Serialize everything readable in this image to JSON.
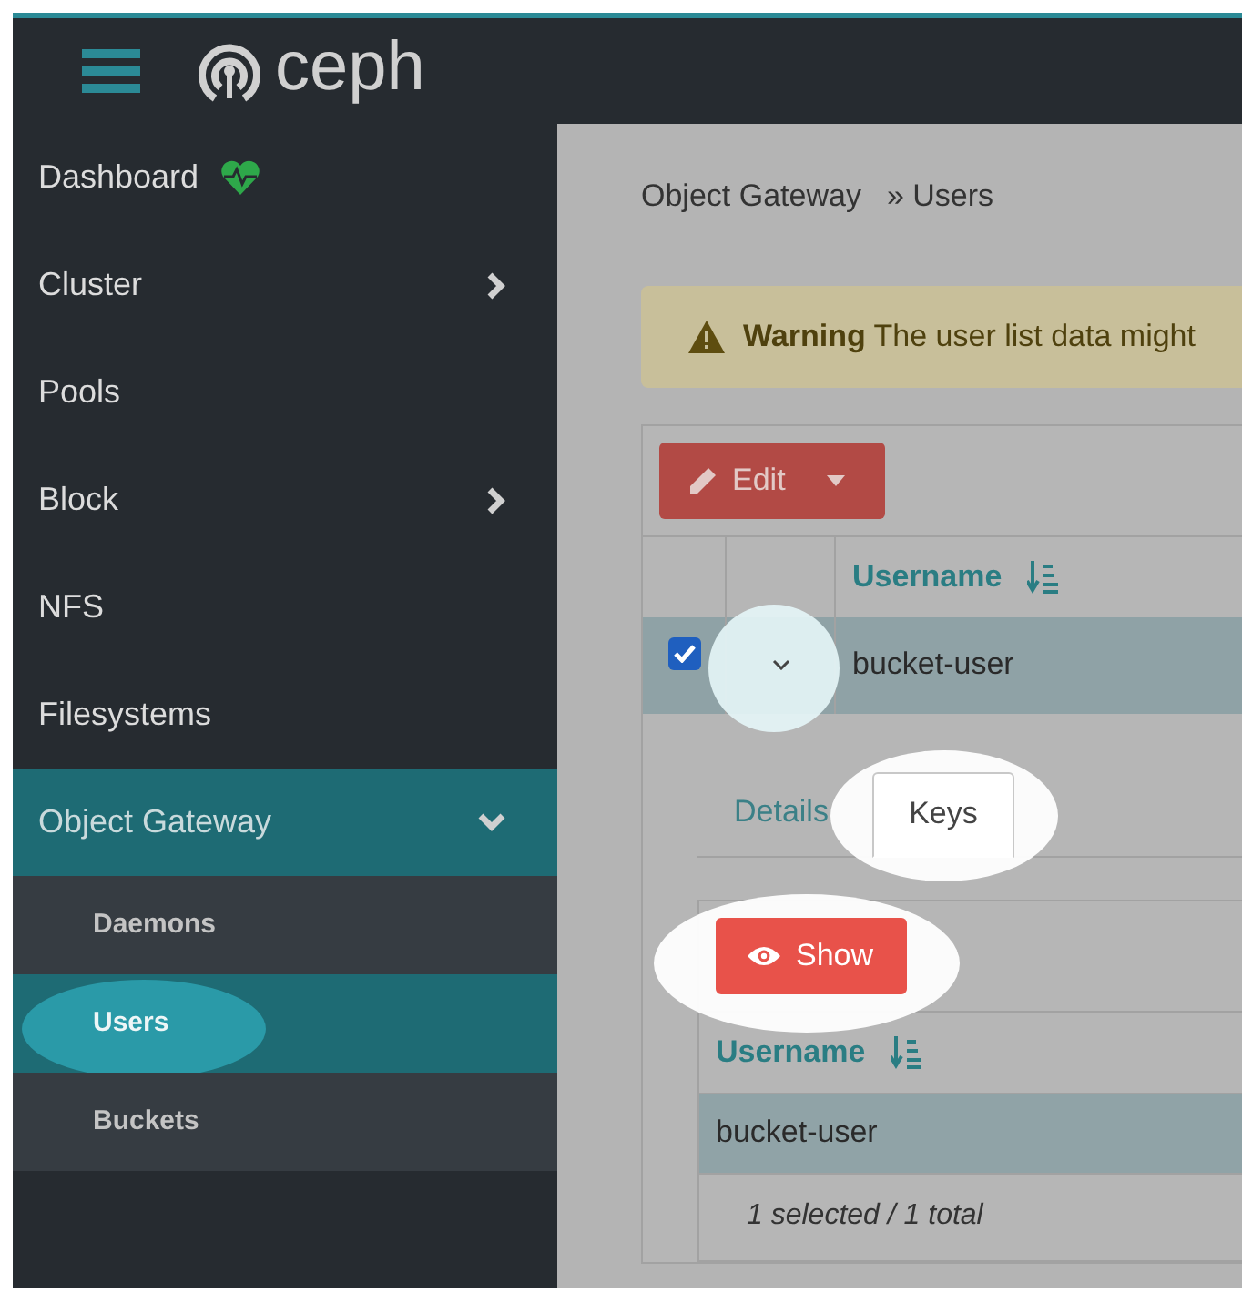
{
  "header": {
    "logo_text": "ceph"
  },
  "sidebar": {
    "items": [
      {
        "label": "Dashboard",
        "kind": "health",
        "selected": false
      },
      {
        "label": "Cluster",
        "kind": "group",
        "selected": false,
        "expanded": false
      },
      {
        "label": "Pools",
        "kind": "link",
        "selected": false
      },
      {
        "label": "Block",
        "kind": "group",
        "selected": false,
        "expanded": false
      },
      {
        "label": "NFS",
        "kind": "link",
        "selected": false
      },
      {
        "label": "Filesystems",
        "kind": "link",
        "selected": false
      },
      {
        "label": "Object Gateway",
        "kind": "group",
        "selected": true,
        "expanded": true,
        "children": [
          {
            "label": "Daemons",
            "selected": false
          },
          {
            "label": "Users",
            "selected": true
          },
          {
            "label": "Buckets",
            "selected": false
          }
        ]
      }
    ]
  },
  "breadcrumb": {
    "items": [
      "Object Gateway",
      "Users"
    ],
    "separator": "»"
  },
  "warning": {
    "title": "Warning",
    "text": "The user list data might"
  },
  "toolbar": {
    "edit_button": "Edit"
  },
  "table": {
    "columns": [
      "Username"
    ],
    "rows": [
      {
        "selected": true,
        "expanded": true,
        "cells": [
          "bucket-user"
        ]
      }
    ]
  },
  "detail": {
    "tabs": [
      {
        "label": "Details",
        "selected": false
      },
      {
        "label": "Keys",
        "selected": true
      }
    ],
    "show_button": "Show",
    "keys_table": {
      "columns": [
        "Username"
      ],
      "rows": [
        {
          "selected": true,
          "cells": [
            "bucket-user"
          ]
        }
      ],
      "footer": "1 selected / 1 total"
    }
  }
}
